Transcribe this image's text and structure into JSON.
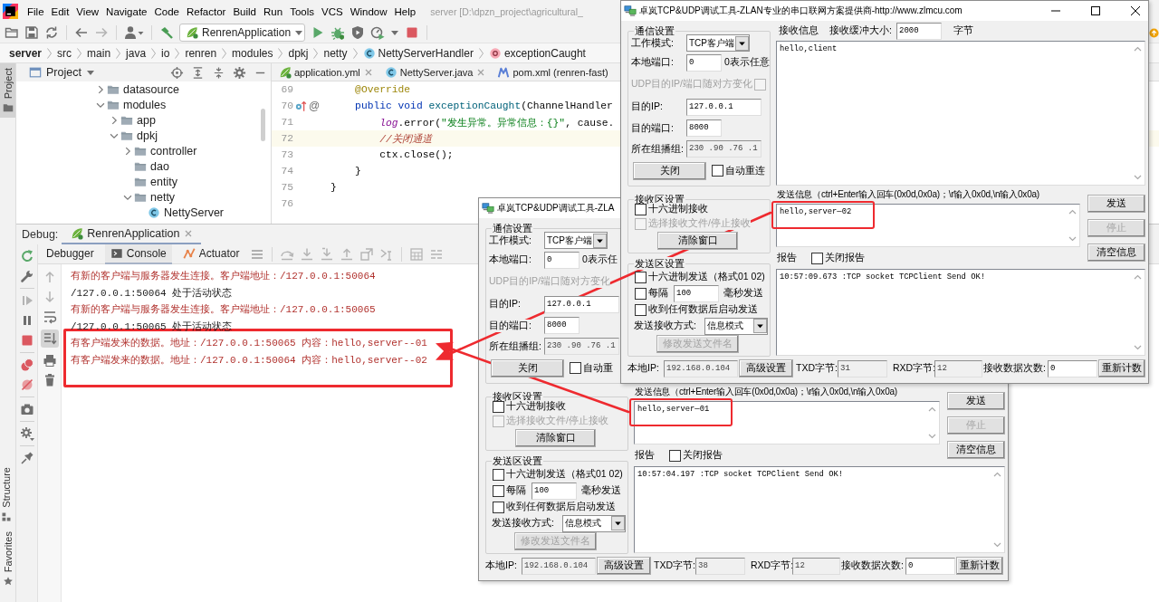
{
  "ide": {
    "menu": [
      "File",
      "Edit",
      "View",
      "Navigate",
      "Code",
      "Refactor",
      "Build",
      "Run",
      "Tools",
      "VCS",
      "Window",
      "Help"
    ],
    "project_title": "server [D:\\dpzn_project\\agricultural_",
    "run_config": "RenrenApplication",
    "breadcrumb": [
      {
        "label": "server",
        "kind": "root"
      },
      {
        "label": "src",
        "kind": "dir"
      },
      {
        "label": "main",
        "kind": "dir"
      },
      {
        "label": "java",
        "kind": "dir"
      },
      {
        "label": "io",
        "kind": "dir"
      },
      {
        "label": "renren",
        "kind": "dir"
      },
      {
        "label": "modules",
        "kind": "dir"
      },
      {
        "label": "dpkj",
        "kind": "dir"
      },
      {
        "label": "netty",
        "kind": "dir"
      },
      {
        "label": "NettyServerHandler",
        "kind": "class"
      },
      {
        "label": "exceptionCaught",
        "kind": "method"
      }
    ],
    "side_tabs": [
      {
        "label": "Project",
        "selected": true
      },
      {
        "label": "Structure",
        "selected": false
      },
      {
        "label": "Favorites",
        "selected": false
      }
    ],
    "project_panel": {
      "title": "Project",
      "tree": [
        {
          "label": "datasource",
          "kind": "folder",
          "expanded": false
        },
        {
          "label": "modules",
          "kind": "folder",
          "expanded": true,
          "children": [
            {
              "label": "app",
              "kind": "folder",
              "expanded": false
            },
            {
              "label": "dpkj",
              "kind": "folder",
              "expanded": true,
              "children": [
                {
                  "label": "controller",
                  "kind": "folder",
                  "expanded": false
                },
                {
                  "label": "dao",
                  "kind": "folder"
                },
                {
                  "label": "entity",
                  "kind": "folder"
                },
                {
                  "label": "netty",
                  "kind": "folder",
                  "expanded": true,
                  "children": [
                    {
                      "label": "NettyServer",
                      "kind": "class"
                    }
                  ]
                }
              ]
            }
          ]
        }
      ]
    },
    "editor": {
      "tabs": [
        {
          "label": "application.yml",
          "kind": "yaml",
          "closable": true
        },
        {
          "label": "NettyServer.java",
          "kind": "class",
          "closable": true
        },
        {
          "label": "pom.xml (renren-fast)",
          "kind": "maven",
          "closable": false
        }
      ],
      "lines": [
        {
          "kind": "block",
          "children": [
            {
              "kind": "line",
              "number": "69",
              "current": false,
              "override_marker": false,
              "tokens": [
                {
                  "text": "@Override",
                  "kind": "annotation"
                }
              ]
            },
            {
              "kind": "line",
              "number": "70",
              "current": false,
              "override_marker": true,
              "gutter_glyph": "@",
              "tokens": [
                {
                  "text": "public void ",
                  "kind": "keyword"
                },
                {
                  "text": "exceptionCaught",
                  "kind": "method"
                },
                {
                  "text": "(ChannelHandler",
                  "kind": "plain"
                }
              ],
              "children": [
                {
                  "kind": "line",
                  "number": "71",
                  "current": false,
                  "override_marker": false,
                  "tokens": [
                    {
                      "text": "log",
                      "kind": "field"
                    },
                    {
                      "text": ".error(",
                      "kind": "plain"
                    },
                    {
                      "text": "\"发生异常。异常信息：{}\"",
                      "kind": "string"
                    },
                    {
                      "text": ", cause.",
                      "kind": "plain"
                    }
                  ]
                },
                {
                  "kind": "line",
                  "number": "72",
                  "current": true,
                  "override_marker": false,
                  "tokens": [
                    {
                      "text": "//关闭通道",
                      "kind": "comment"
                    }
                  ]
                },
                {
                  "kind": "line",
                  "number": "73",
                  "current": false,
                  "override_marker": false,
                  "tokens": [
                    {
                      "text": "ctx.close();",
                      "kind": "plain"
                    }
                  ]
                }
              ]
            },
            {
              "kind": "line",
              "number": "74",
              "current": false,
              "override_marker": false,
              "tokens": [
                {
                  "text": "}",
                  "kind": "plain"
                }
              ]
            }
          ]
        },
        {
          "kind": "line",
          "number": "75",
          "current": false,
          "override_marker": false,
          "tokens": [
            {
              "text": "}",
              "kind": "plain"
            }
          ]
        },
        {
          "kind": "line",
          "number": "76",
          "current": false,
          "override_marker": false
        }
      ]
    },
    "debug": {
      "title": "Debug:",
      "session": "RenrenApplication",
      "tabs": [
        {
          "label": "Debugger",
          "selected": false
        },
        {
          "label": "Console",
          "selected": true
        },
        {
          "label": "Actuator",
          "selected": false
        }
      ],
      "console": [
        {
          "text": "有新的客户端与服务器发生连接。客户端地址：/127.0.0.1:50064",
          "kind": "stderr",
          "highlighted": false
        },
        {
          "text": "/127.0.0.1:50064 处于活动状态",
          "kind": "stdout",
          "highlighted": false
        },
        {
          "text": "有新的客户端与服务器发生连接。客户端地址：/127.0.0.1:50065",
          "kind": "stderr",
          "highlighted": false
        },
        {
          "text": "/127.0.0.1:50065 处于活动状态",
          "kind": "stdout",
          "highlighted": false
        },
        {
          "text": "有客户端发来的数据。地址：/127.0.0.1:50065 内容：hello,server--01",
          "kind": "stderr",
          "highlighted": true
        },
        {
          "text": "有客户端发来的数据。地址：/127.0.0.1:50064 内容：hello,server--02",
          "kind": "stderr",
          "highlighted": true
        }
      ]
    }
  },
  "windows": [
    {
      "title": "卓岚TCP&UDP调试工具-ZLA",
      "window_buttons": false,
      "comm": {
        "legend": "通信设置",
        "work_mode": {
          "label": "工作模式:",
          "value": "TCP客户端"
        },
        "local_port": {
          "label": "本地端口:",
          "value": "0",
          "hint": "0表示任"
        },
        "udp_follow": {
          "label": "UDP目的IP/端口随对方变化",
          "disabled": true
        },
        "dest_ip": {
          "label": "目的IP:",
          "value": "127.0.0.1"
        },
        "dest_port": {
          "label": "目的端口:",
          "value": "8000"
        },
        "multicast": {
          "label": "所在组播组:",
          "value": "230 .90 .76 .1",
          "disabled": true
        },
        "connect_button": "关闭",
        "auto_reconnect": {
          "label": "自动重",
          "checked": false
        }
      },
      "receive_settings": {
        "legend": "接收区设置",
        "options": [
          {
            "label": "十六进制接收",
            "checked": false,
            "disabled": false
          },
          {
            "label": "选择接收文件/停止接收",
            "checked": false,
            "disabled": true
          }
        ],
        "clear_button": "清除窗口"
      },
      "send_settings": {
        "legend": "发送区设置",
        "rows": [
          {
            "kind": "checkbox",
            "label": "十六进制发送（格式01 02)",
            "checked": false
          },
          {
            "kind": "interval",
            "label": "每隔",
            "value": "100",
            "unit": "毫秒发送",
            "checked": false
          },
          {
            "kind": "checkbox",
            "label": "收到任何数据后启动发送",
            "checked": false
          },
          {
            "kind": "select",
            "label": "发送接收方式:",
            "value": "信息模式"
          },
          {
            "kind": "button",
            "label": "修改发送文件名",
            "disabled": true
          }
        ]
      },
      "send": {
        "label": "发送信息（ctrl+Enter输入回车(0x0d,0x0a)；\\r输入0x0d,\\n输入0x0a)",
        "content": "hello,server—01",
        "highlighted": true
      },
      "buttons": [
        {
          "label": "发送",
          "disabled": false
        },
        {
          "label": "停止",
          "disabled": true
        },
        {
          "label": "清空信息",
          "disabled": false
        }
      ],
      "report": {
        "label": "报告",
        "close_report": {
          "label": "关闭报告",
          "checked": false
        },
        "content": "10:57:04.197 :TCP socket TCPClient Send OK!"
      },
      "status": [
        {
          "kind": "label",
          "text": "本地IP:"
        },
        {
          "kind": "field",
          "value": "192.168.0.104",
          "disabled": true
        },
        {
          "kind": "button",
          "label": "高级设置"
        },
        {
          "kind": "label",
          "text": "TXD字节:"
        },
        {
          "kind": "field",
          "value": "38",
          "disabled": true
        },
        {
          "kind": "label",
          "text": "RXD字节:"
        },
        {
          "kind": "field",
          "value": "12",
          "disabled": true
        },
        {
          "kind": "label",
          "text": "接收数据次数:"
        },
        {
          "kind": "field",
          "value": "0",
          "disabled": false
        },
        {
          "kind": "button",
          "label": "重新计数"
        }
      ]
    },
    {
      "title": "卓岚TCP&UDP调试工具-ZLAN专业的串口联网方案提供商-http://www.zlmcu.com",
      "window_buttons": true,
      "comm": {
        "legend": "通信设置",
        "work_mode": {
          "label": "工作模式:",
          "value": "TCP客户端"
        },
        "local_port": {
          "label": "本地端口:",
          "value": "0",
          "hint": "0表示任意"
        },
        "udp_follow": {
          "label": "UDP目的IP/端口随对方变化",
          "checked": false,
          "disabled": true
        },
        "dest_ip": {
          "label": "目的IP:",
          "value": "127.0.0.1"
        },
        "dest_port": {
          "label": "目的端口:",
          "value": "8000"
        },
        "multicast": {
          "label": "所在组播组:",
          "value": "230 .90 .76 .1",
          "disabled": true
        },
        "connect_button": "关闭",
        "auto_reconnect": {
          "label": "自动重连",
          "checked": false
        }
      },
      "receive": {
        "label": "接收信息",
        "buffer_label": "接收缓冲大小:",
        "buffer_value": "2000",
        "unit": "字节",
        "content": "hello,client"
      },
      "receive_settings": {
        "legend": "接收区设置",
        "options": [
          {
            "label": "十六进制接收",
            "checked": false,
            "disabled": false
          },
          {
            "label": "选择接收文件/停止接收",
            "checked": false,
            "disabled": true
          }
        ],
        "clear_button": "清除窗口"
      },
      "send_settings": {
        "legend": "发送区设置",
        "rows": [
          {
            "kind": "checkbox",
            "label": "十六进制发送（格式01 02)",
            "checked": false
          },
          {
            "kind": "interval",
            "label": "每隔",
            "value": "100",
            "unit": "毫秒发送",
            "checked": false
          },
          {
            "kind": "checkbox",
            "label": "收到任何数据后启动发送",
            "checked": false
          },
          {
            "kind": "select",
            "label": "发送接收方式:",
            "value": "信息模式"
          },
          {
            "kind": "button",
            "label": "修改发送文件名",
            "disabled": true
          }
        ]
      },
      "send": {
        "label": "发送信息（ctrl+Enter输入回车(0x0d,0x0a)；\\r输入0x0d,\\n输入0x0a)",
        "content": "hello,server—02",
        "highlighted": true
      },
      "buttons": [
        {
          "label": "发送",
          "disabled": false
        },
        {
          "label": "停止",
          "disabled": true
        },
        {
          "label": "清空信息",
          "disabled": false
        }
      ],
      "report": {
        "label": "报告",
        "close_report": {
          "label": "关闭报告",
          "checked": false
        },
        "content": "10:57:09.673 :TCP socket TCPClient Send OK!"
      },
      "status": [
        {
          "kind": "label",
          "text": "本地IP:"
        },
        {
          "kind": "field",
          "value": "192.168.0.104",
          "disabled": true
        },
        {
          "kind": "button",
          "label": "高级设置"
        },
        {
          "kind": "label",
          "text": "TXD字节:"
        },
        {
          "kind": "field",
          "value": "31",
          "disabled": true
        },
        {
          "kind": "label",
          "text": "RXD字节:"
        },
        {
          "kind": "field",
          "value": "12",
          "disabled": true
        },
        {
          "kind": "label",
          "text": "接收数据次数:"
        },
        {
          "kind": "field",
          "value": "0",
          "disabled": false
        },
        {
          "kind": "button",
          "label": "重新计数"
        }
      ]
    }
  ]
}
